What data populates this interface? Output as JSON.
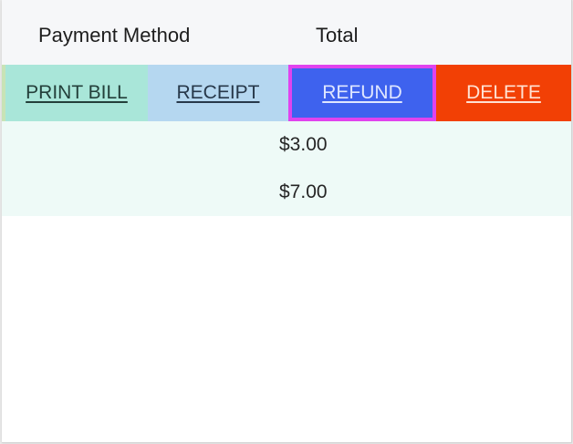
{
  "header": {
    "payment_method": "Payment Method",
    "total": "Total"
  },
  "actions": {
    "print_bill": "PRINT BILL",
    "receipt": "RECEIPT",
    "refund": "REFUND",
    "delete": "DELETE"
  },
  "rows": [
    {
      "payment_method": "",
      "total": "$3.00"
    },
    {
      "payment_method": "",
      "total": "$7.00"
    }
  ],
  "colors": {
    "print_bill_bg": "#a9e6d9",
    "receipt_bg": "#b5d7f0",
    "refund_bg": "#3e62ee",
    "refund_highlight": "#e043ee",
    "delete_bg": "#f24005",
    "rows_bg": "#eefaf7"
  }
}
